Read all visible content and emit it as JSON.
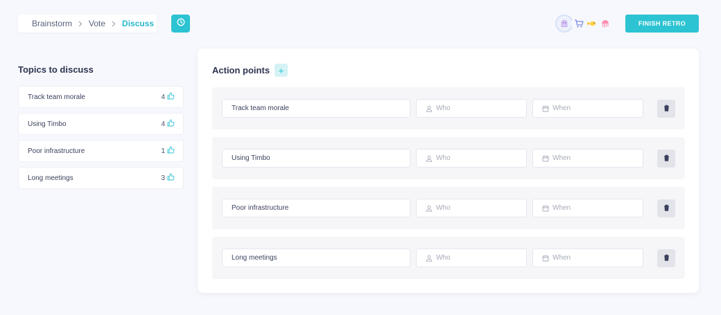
{
  "breadcrumb": {
    "steps": [
      {
        "label": "Brainstorm"
      },
      {
        "label": "Vote"
      },
      {
        "label": "Discuss"
      }
    ]
  },
  "header": {
    "timer_icon": "clock-icon",
    "finish_label": "FINISH RETRO",
    "avatars": [
      {
        "icon": "ghost-avatar",
        "color": "#d9c6f5"
      },
      {
        "icon": "shopping-cart-avatar",
        "color": "#c9d5ff"
      },
      {
        "icon": "fish-avatar",
        "color": "#ffe07a"
      },
      {
        "icon": "jellyfish-avatar",
        "color": "#ff8fb0"
      }
    ]
  },
  "sidebar": {
    "title": "Topics to discuss",
    "topics": [
      {
        "label": "Track team morale",
        "votes": "4"
      },
      {
        "label": "Using Timbo",
        "votes": "4"
      },
      {
        "label": "Poor infrastructure",
        "votes": "1"
      },
      {
        "label": "Long meetings",
        "votes": "3"
      }
    ]
  },
  "main": {
    "title": "Action points",
    "add_label": "+",
    "rows": [
      {
        "topic": "Track team morale",
        "who_placeholder": "Who",
        "when_placeholder": "When"
      },
      {
        "topic": "Using Timbo",
        "who_placeholder": "Who",
        "when_placeholder": "When"
      },
      {
        "topic": "Poor infrastructure",
        "who_placeholder": "Who",
        "when_placeholder": "When"
      },
      {
        "topic": "Long meetings",
        "who_placeholder": "Who",
        "when_placeholder": "When"
      }
    ]
  },
  "colors": {
    "accent": "#2cc3d2",
    "background": "#f7f8fd",
    "row_background": "#f6f6f9"
  }
}
